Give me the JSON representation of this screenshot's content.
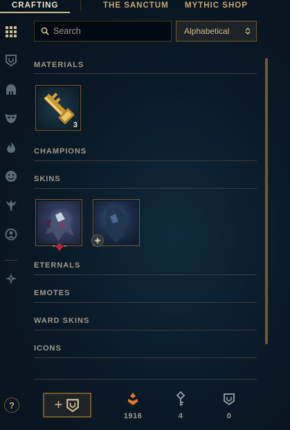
{
  "top_tabs": [
    {
      "label": "CRAFTING",
      "active": true
    },
    {
      "label": "THE SANCTUM",
      "active": false
    },
    {
      "label": "MYTHIC SHOP",
      "active": false
    }
  ],
  "sidebar": {
    "items": [
      {
        "name": "all-items-grid-icon"
      },
      {
        "name": "chest-icon"
      },
      {
        "name": "champion-helmet-icon"
      },
      {
        "name": "skin-mask-icon"
      },
      {
        "name": "eternals-flame-icon"
      },
      {
        "name": "emote-face-icon"
      },
      {
        "name": "ward-icon"
      },
      {
        "name": "summoner-icon-icon"
      },
      {
        "name": "tft-icon"
      }
    ]
  },
  "search": {
    "placeholder": "Search",
    "value": ""
  },
  "sort": {
    "selected": "Alphabetical"
  },
  "sections": [
    {
      "title": "MATERIALS"
    },
    {
      "title": "CHAMPIONS"
    },
    {
      "title": "SKINS"
    },
    {
      "title": "ETERNALS"
    },
    {
      "title": "EMOTES"
    },
    {
      "title": "WARD SKINS"
    },
    {
      "title": "ICONS"
    }
  ],
  "materials": [
    {
      "name": "hextech-key",
      "count": "3"
    }
  ],
  "skins": [
    {
      "name": "skin-shard-1",
      "badge": "gemstone"
    },
    {
      "name": "skin-shard-2",
      "badge": "legacy"
    }
  ],
  "footer": {
    "help_label": "?",
    "add_label": "+",
    "currencies": [
      {
        "icon": "orange-essence-icon",
        "value": "1916"
      },
      {
        "icon": "key-fragment-icon",
        "value": "4"
      },
      {
        "icon": "chest-icon",
        "value": "0"
      }
    ]
  },
  "colors": {
    "gold": "#c8aa6e",
    "gold_dark": "#785a28",
    "text": "#a09b8c",
    "orange_essence": "#e8792a",
    "background": "#0b1724"
  }
}
